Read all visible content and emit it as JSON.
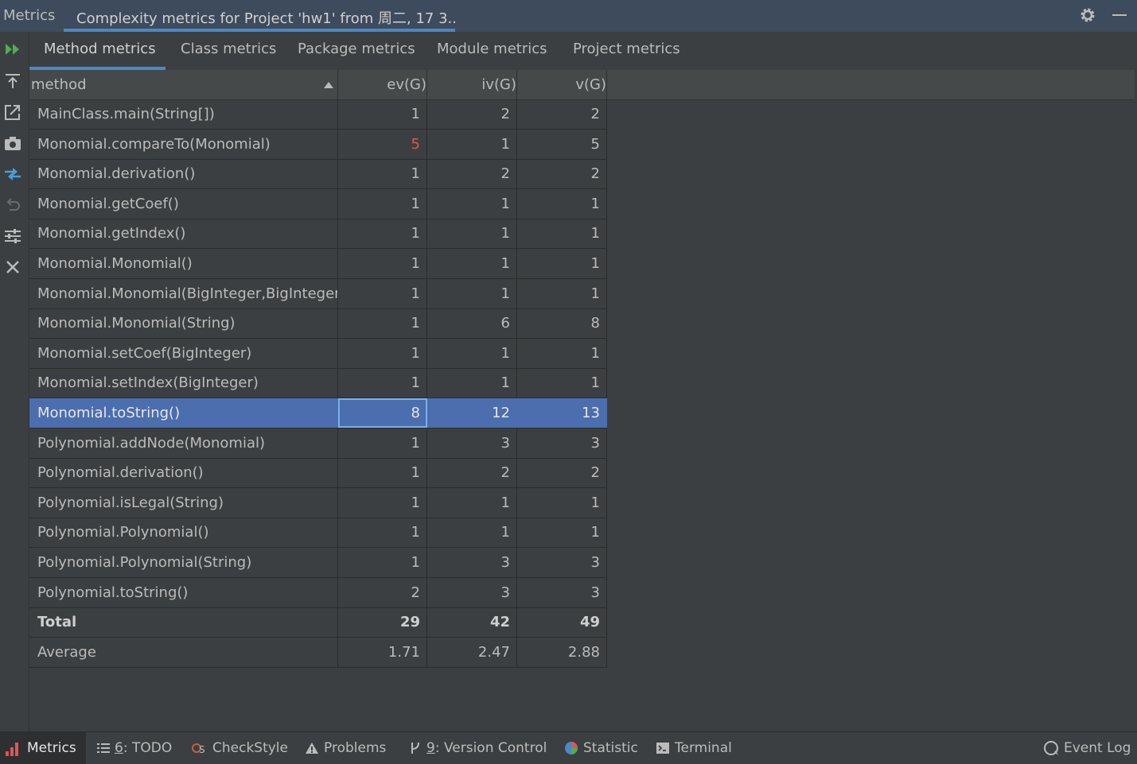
{
  "header": {
    "app_title": "Metrics",
    "tab_title": "Complexity metrics for Project 'hw1' from 周二, 17 3..."
  },
  "tabs": [
    {
      "label": "Method metrics"
    },
    {
      "label": "Class metrics"
    },
    {
      "label": "Package metrics"
    },
    {
      "label": "Module metrics"
    },
    {
      "label": "Project metrics"
    }
  ],
  "table": {
    "columns": [
      "method",
      "ev(G)",
      "iv(G)",
      "v(G)"
    ],
    "rows": [
      {
        "method": "MainClass.main(String[])",
        "ev": "1",
        "iv": "2",
        "v": "2"
      },
      {
        "method": "Monomial.compareTo(Monomial)",
        "ev": "5",
        "iv": "1",
        "v": "5"
      },
      {
        "method": "Monomial.derivation()",
        "ev": "1",
        "iv": "2",
        "v": "2"
      },
      {
        "method": "Monomial.getCoef()",
        "ev": "1",
        "iv": "1",
        "v": "1"
      },
      {
        "method": "Monomial.getIndex()",
        "ev": "1",
        "iv": "1",
        "v": "1"
      },
      {
        "method": "Monomial.Monomial()",
        "ev": "1",
        "iv": "1",
        "v": "1"
      },
      {
        "method": "Monomial.Monomial(BigInteger,BigInteger)",
        "ev": "1",
        "iv": "1",
        "v": "1"
      },
      {
        "method": "Monomial.Monomial(String)",
        "ev": "1",
        "iv": "6",
        "v": "8"
      },
      {
        "method": "Monomial.setCoef(BigInteger)",
        "ev": "1",
        "iv": "1",
        "v": "1"
      },
      {
        "method": "Monomial.setIndex(BigInteger)",
        "ev": "1",
        "iv": "1",
        "v": "1"
      },
      {
        "method": "Monomial.toString()",
        "ev": "8",
        "iv": "12",
        "v": "13"
      },
      {
        "method": "Polynomial.addNode(Monomial)",
        "ev": "1",
        "iv": "3",
        "v": "3"
      },
      {
        "method": "Polynomial.derivation()",
        "ev": "1",
        "iv": "2",
        "v": "2"
      },
      {
        "method": "Polynomial.isLegal(String)",
        "ev": "1",
        "iv": "1",
        "v": "1"
      },
      {
        "method": "Polynomial.Polynomial()",
        "ev": "1",
        "iv": "1",
        "v": "1"
      },
      {
        "method": "Polynomial.Polynomial(String)",
        "ev": "1",
        "iv": "3",
        "v": "3"
      },
      {
        "method": "Polynomial.toString()",
        "ev": "2",
        "iv": "3",
        "v": "3"
      }
    ],
    "total": {
      "method": "Total",
      "ev": "29",
      "iv": "42",
      "v": "49"
    },
    "average": {
      "method": "Average",
      "ev": "1.71",
      "iv": "2.47",
      "v": "2.88"
    }
  },
  "statusbar": {
    "metrics": "Metrics",
    "todo_num": "6",
    "todo": ": TODO",
    "checkstyle": "CheckStyle",
    "problems": "Problems",
    "vc_num": "9",
    "vc": ": Version Control",
    "statistic": "Statistic",
    "terminal": "Terminal",
    "event_log": "Event Log"
  },
  "colors": {
    "background": "#3c3f41",
    "header": "#3d4b5c",
    "accent": "#4a88c7",
    "selection": "#4b6eaf",
    "warning_red": "#e05555",
    "run_green": "#4caf50"
  }
}
